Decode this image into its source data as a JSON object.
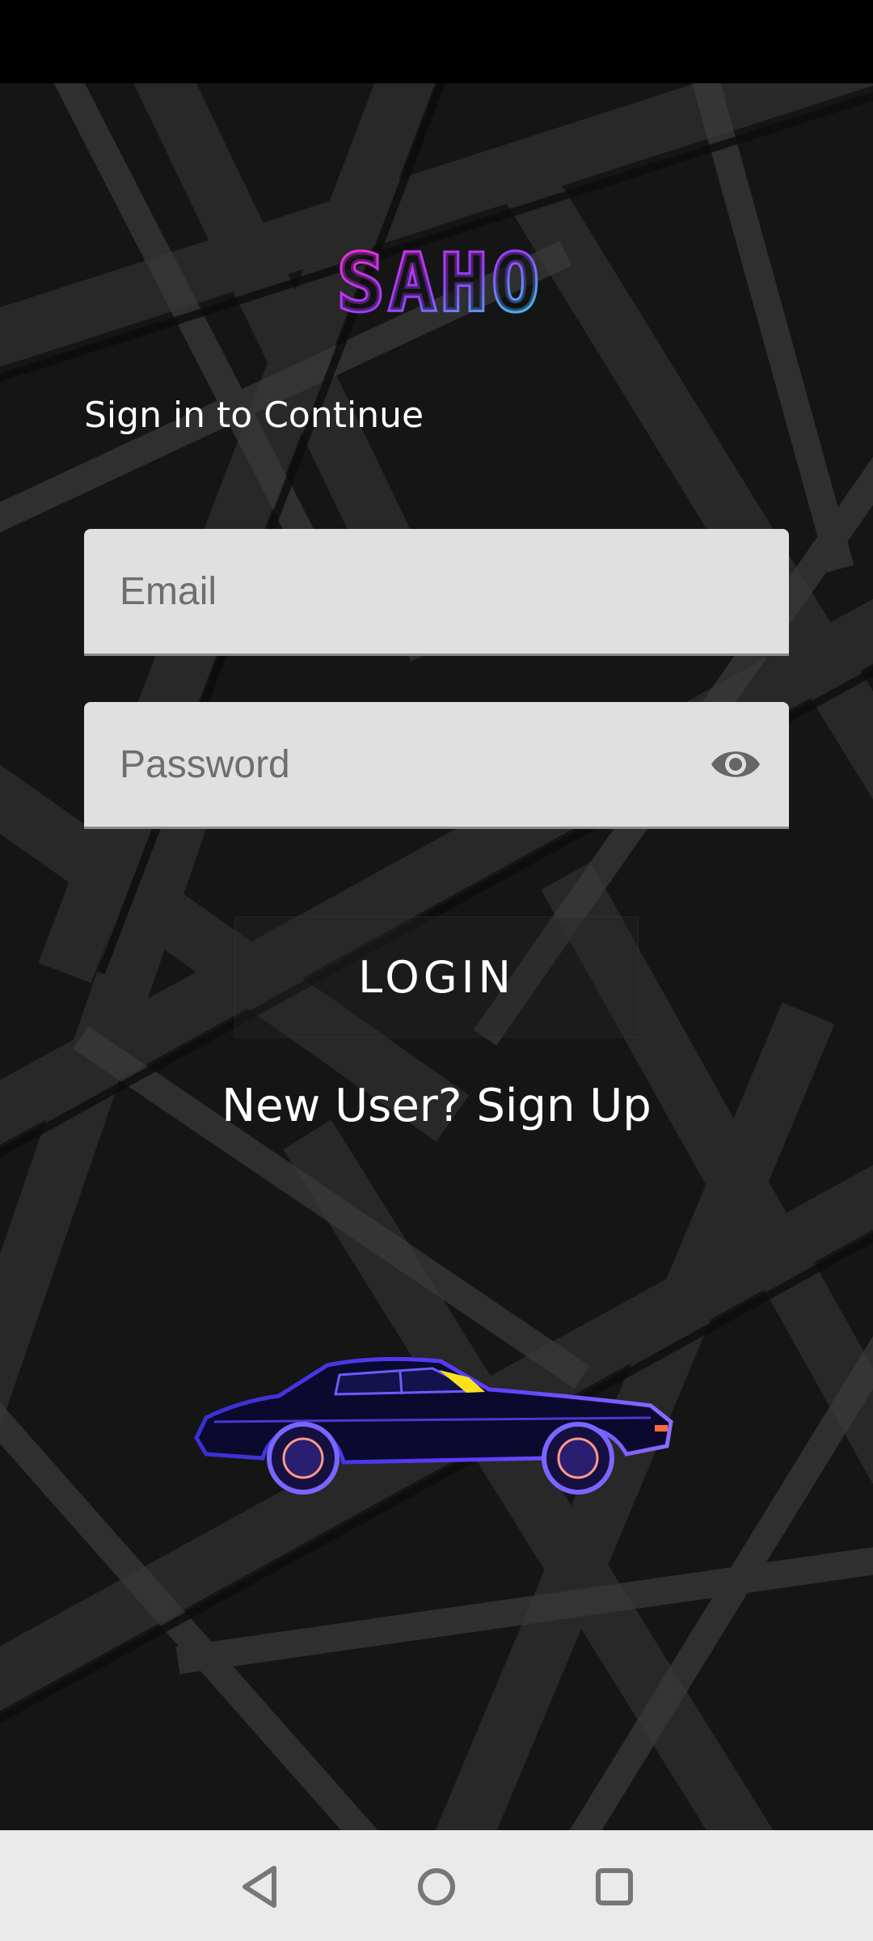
{
  "app": {
    "logo_text": "SAHO",
    "subtitle": "Sign in to Continue"
  },
  "form": {
    "email_placeholder": "Email",
    "password_placeholder": "Password",
    "login_label": "LOGIN",
    "signup_label": "New User? Sign Up"
  },
  "icons": {
    "password_toggle": "eye-icon",
    "nav_back": "triangle-back-icon",
    "nav_home": "circle-home-icon",
    "nav_recent": "square-recents-icon"
  },
  "colors": {
    "background": "#151515",
    "logo_pink": "#ff2bd6",
    "logo_cyan": "#22e6e6",
    "field_bg": "#e0e0e0",
    "text": "#ffffff"
  }
}
